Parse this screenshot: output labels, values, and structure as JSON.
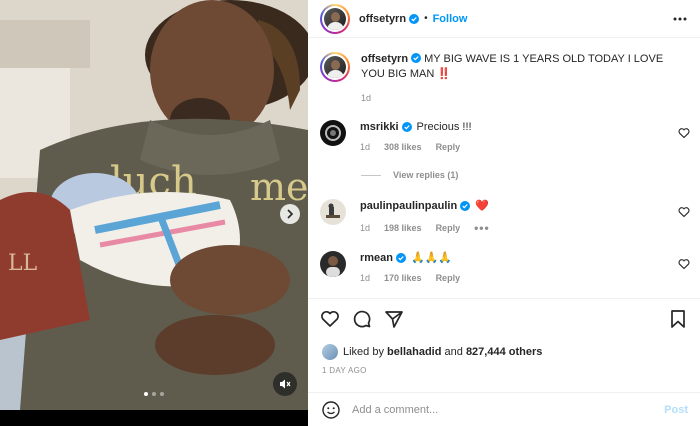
{
  "post": {
    "author": "offsetyrn",
    "follow_label": "Follow",
    "separator": "•",
    "caption": "MY BIG WAVE IS 1 YEARS OLD TODAY I LOVE YOU BIG MAN ‼️",
    "caption_time": "1d",
    "media_slides": 3,
    "media_active_slide": 1
  },
  "comments": [
    {
      "user": "msrikki",
      "text": "Precious !!!",
      "time": "1d",
      "likes": "308 likes",
      "reply_label": "Reply"
    },
    {
      "user": "paulinpaulinpaulin",
      "text": "❤️",
      "time": "1d",
      "likes": "198 likes",
      "reply_label": "Reply",
      "more": "•••"
    },
    {
      "user": "rmean",
      "text": "🙏🙏🙏",
      "time": "1d",
      "likes": "170 likes",
      "reply_label": "Reply"
    }
  ],
  "view_replies": "View replies (1)",
  "liked_by": {
    "prefix": "Liked by",
    "user": "bellahadid",
    "and": "and",
    "others": "827,444 others"
  },
  "post_date": "1 DAY AGO",
  "add_comment": {
    "placeholder": "Add a comment...",
    "post_label": "Post"
  },
  "colors": {
    "accent": "#0095f6",
    "post_disabled": "#b2dffc",
    "muted": "#8e8e8e",
    "heart_red": "#ed4956"
  },
  "icons": [
    "chevron-right-icon",
    "mute-icon",
    "verified-badge-icon",
    "more-icon",
    "heart-icon",
    "comment-icon",
    "share-icon",
    "bookmark-icon",
    "emoji-icon"
  ]
}
